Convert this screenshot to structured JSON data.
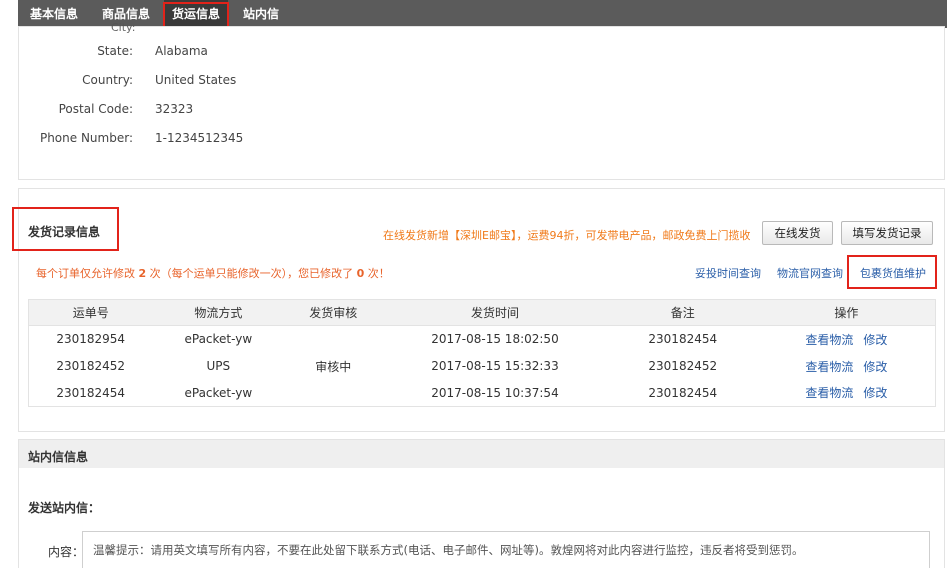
{
  "tabs": [
    {
      "label": "基本信息"
    },
    {
      "label": "商品信息"
    },
    {
      "label": "货运信息"
    },
    {
      "label": "站内信"
    }
  ],
  "address": {
    "ghost_label": "City:",
    "rows": [
      {
        "label": "State:",
        "value": "Alabama"
      },
      {
        "label": "Country:",
        "value": "United States"
      },
      {
        "label": "Postal Code:",
        "value": "32323"
      },
      {
        "label": "Phone Number:",
        "value": "1-1234512345"
      }
    ]
  },
  "shipment": {
    "title": "发货记录信息",
    "promo": "在线发货新增【深圳E邮宝】，运费94折，可发带电产品，邮政免费上门揽收",
    "buttons": {
      "online_ship": "在线发货",
      "fill_record": "填写发货记录"
    },
    "notice": {
      "part1": "每个订单仅允许修改 ",
      "count1": "2",
      "part2": " 次（每个运单只能修改一次），您已修改了 ",
      "count2": "0",
      "part3": " 次！"
    },
    "links": {
      "delivery_query": "妥投时间查询",
      "carrier_query": "物流官网查询",
      "parcel_value": "包裹货值维护"
    },
    "columns": [
      "运单号",
      "物流方式",
      "发货审核",
      "发货时间",
      "备注",
      "操作"
    ],
    "rows": [
      {
        "tracking": "230182954",
        "method": "ePacket-yw",
        "review": "",
        "time": "2017-08-15 18:02:50",
        "note": "230182454",
        "view": "查看物流",
        "edit": "修改"
      },
      {
        "tracking": "230182452",
        "method": "UPS",
        "review": "审核中",
        "time": "2017-08-15 15:32:33",
        "note": "230182452",
        "view": "查看物流",
        "edit": "修改"
      },
      {
        "tracking": "230182454",
        "method": "ePacket-yw",
        "review": "",
        "time": "2017-08-15 10:37:54",
        "note": "230182454",
        "view": "查看物流",
        "edit": "修改"
      }
    ]
  },
  "messages": {
    "title": "站内信信息",
    "send_title": "发送站内信：",
    "content_label": "内容：",
    "hint": "温馨提示：请用英文填写所有内容，不要在此处留下联系方式(电话、电子邮件、网址等)。敦煌网将对此内容进行监控，违反者将受到惩罚。"
  }
}
